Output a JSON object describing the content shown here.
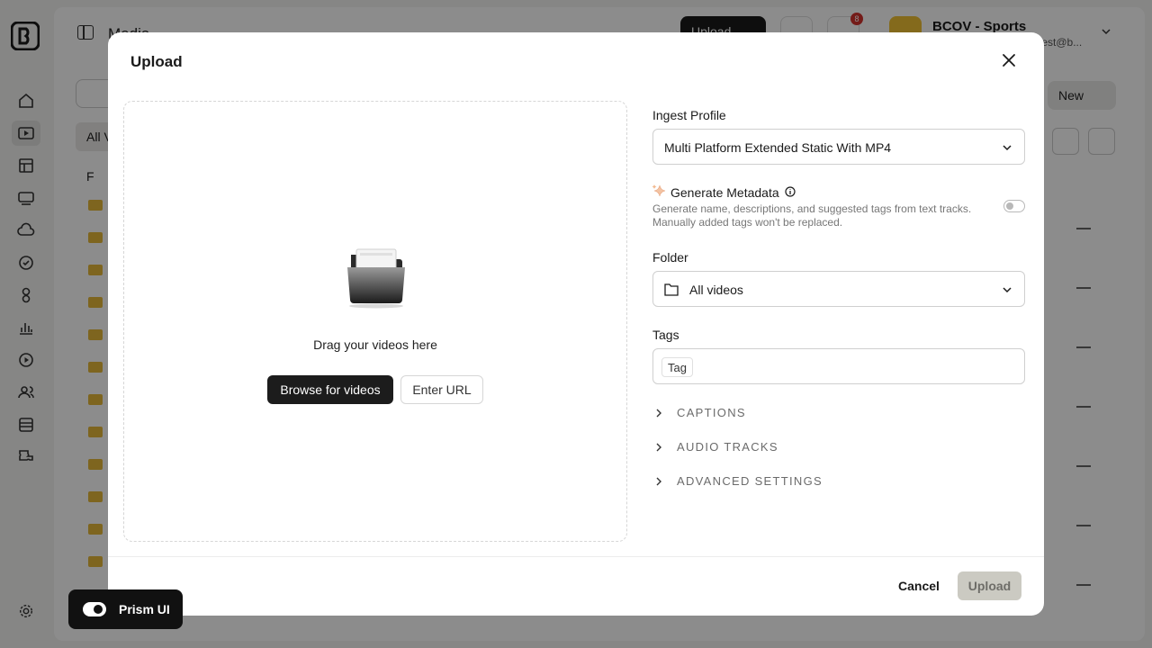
{
  "app": {
    "page_title": "Media",
    "header_upload_label": "Upload",
    "notification_count": "8",
    "account_name": "BCOV - Sports",
    "account_email": "-test@b...",
    "new_button_label": "New",
    "all_videos_tab": "All V",
    "folder_tree_label": "F"
  },
  "modal": {
    "title": "Upload",
    "dropzone": {
      "instruction": "Drag your videos here",
      "browse_label": "Browse for videos",
      "url_label": "Enter URL"
    },
    "ingest_profile": {
      "label": "Ingest Profile",
      "value": "Multi Platform Extended Static With MP4"
    },
    "generate_metadata": {
      "label": "Generate Metadata",
      "description": "Generate name, descriptions, and suggested tags from text tracks. Manually added tags won't be replaced.",
      "enabled": false
    },
    "folder": {
      "label": "Folder",
      "value": "All videos"
    },
    "tags": {
      "label": "Tags",
      "chip": "Tag"
    },
    "sections": [
      {
        "label": "CAPTIONS"
      },
      {
        "label": "AUDIO TRACKS"
      },
      {
        "label": "ADVANCED SETTINGS"
      }
    ],
    "footer": {
      "cancel_label": "Cancel",
      "upload_label": "Upload"
    }
  },
  "prism": {
    "label": "Prism UI",
    "enabled": true
  },
  "colors": {
    "primary_dark": "#1c1c1c",
    "upload_disabled_bg": "#cbcac2",
    "folder_yellow": "#e6b93a",
    "badge_red": "#d4322c",
    "avatar_yellow": "#f1c233"
  }
}
